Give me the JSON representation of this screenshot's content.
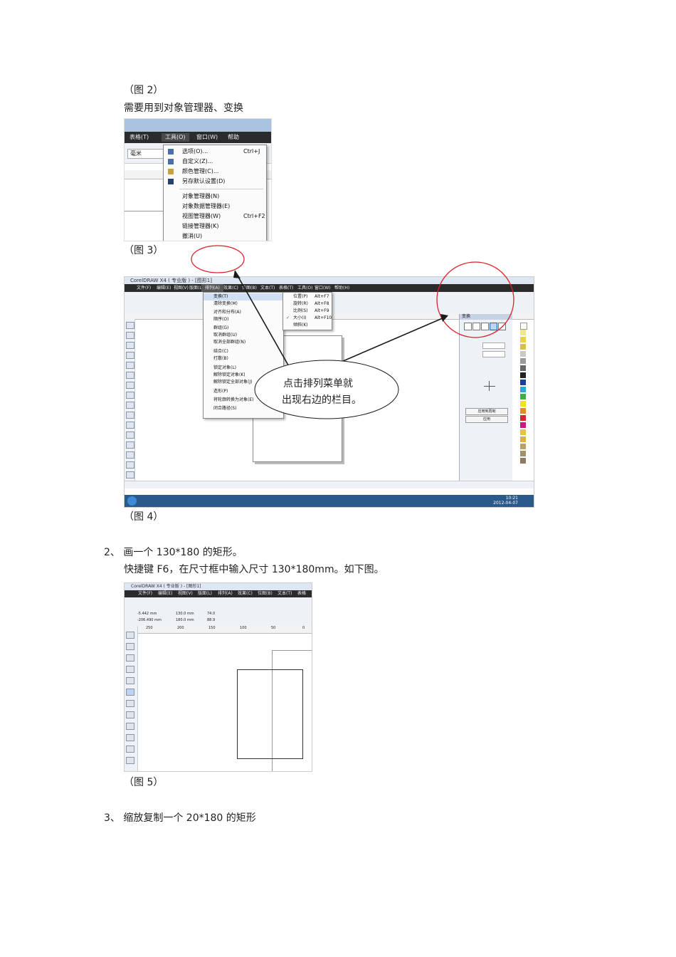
{
  "caption_fig2": "（图 2）",
  "note_manager": "需要用到对象管理器、变换",
  "shot3": {
    "menubar": [
      "表格(T)",
      "工具(O)",
      "窗口(W)",
      "帮助"
    ],
    "unit_select": "毫米",
    "menu_items": [
      {
        "label": "选项(O)...",
        "shortcut": "Ctrl+J"
      },
      {
        "label": "自定义(Z)...",
        "shortcut": ""
      },
      {
        "label": "颜色管理(C)...",
        "shortcut": ""
      },
      {
        "label": "另存默认设置(D)",
        "shortcut": ""
      },
      {
        "label": "对象管理器(N)",
        "shortcut": ""
      },
      {
        "label": "对象数据管理器(E)",
        "shortcut": ""
      },
      {
        "label": "视图管理器(W)",
        "shortcut": "Ctrl+F2"
      },
      {
        "label": "链接管理器(K)",
        "shortcut": ""
      },
      {
        "label": "撤消(U)",
        "shortcut": ""
      }
    ]
  },
  "caption_fig3": "（图 3）",
  "shot4": {
    "title": "CorelDRAW X4 ( 专业版 ) - [图形1]",
    "menubar": [
      "文件(F)",
      "编辑(E)",
      "视图(V)",
      "版面(L)",
      "排列(A)",
      "效果(C)",
      "位图(B)",
      "文本(T)",
      "表格(T)",
      "工具(O)",
      "窗口(W)",
      "帮助(H)"
    ],
    "arrange_items": [
      "变换(T)",
      "清除变换(M)",
      "对齐和分布(A)",
      "顺序(O)",
      "群组(G)",
      "取消群组(U)",
      "取消全部群组(N)",
      "结合(C)",
      "打散(B)",
      "锁定对象(L)",
      "解除锁定对象(K)",
      "解除锁定全部对象(J)",
      "造形(P)",
      "将轮廓转换为对象(E)",
      "闭合路径(S)"
    ],
    "transform_items": [
      {
        "label": "位置(P)",
        "shortcut": "Alt+F7"
      },
      {
        "label": "旋转(R)",
        "shortcut": "Alt+F8"
      },
      {
        "label": "比例(S)",
        "shortcut": "Alt+F9"
      },
      {
        "label": "大小(I)",
        "shortcut": "Alt+F10"
      },
      {
        "label": "倾斜(K)",
        "shortcut": ""
      }
    ],
    "callout": [
      "点击排列菜单就",
      "出现右边的栏目。"
    ],
    "docker_title": "变换",
    "docker_buttons": [
      "应用到再制",
      "应用"
    ],
    "clock": [
      "10:21",
      "2012-04-07"
    ]
  },
  "caption_fig4": "（图 4）",
  "step2": "2、 画一个 130*180 的矩形。",
  "step2_detail": "快捷键 F6，在尺寸框中输入尺寸 130*180mm。如下图。",
  "shot5": {
    "title": "CorelDRAW X4 ( 专业版 ) - [图形1]",
    "menubar": [
      "文件(F)",
      "编辑(E)",
      "视图(V)",
      "版面(L)",
      "排列(A)",
      "效果(C)",
      "位图(B)",
      "文本(T)",
      "表格"
    ],
    "x_value": "-5.442 mm",
    "y_value": "-206.490 mm",
    "w_value": "130.0 mm",
    "h_value": "180.0 mm",
    "sx_value": "74.0",
    "sy_value": "88.9",
    "ruler_ticks": [
      "250",
      "200",
      "150",
      "100",
      "50",
      "0"
    ]
  },
  "caption_fig5": "（图 5）",
  "step3": "3、 缩放复制一个 20*180 的矩形",
  "colors": {
    "callout_circle": "#d9242b",
    "arrow": "#1a1a1a",
    "menu_dark": "#2b2b2b"
  }
}
